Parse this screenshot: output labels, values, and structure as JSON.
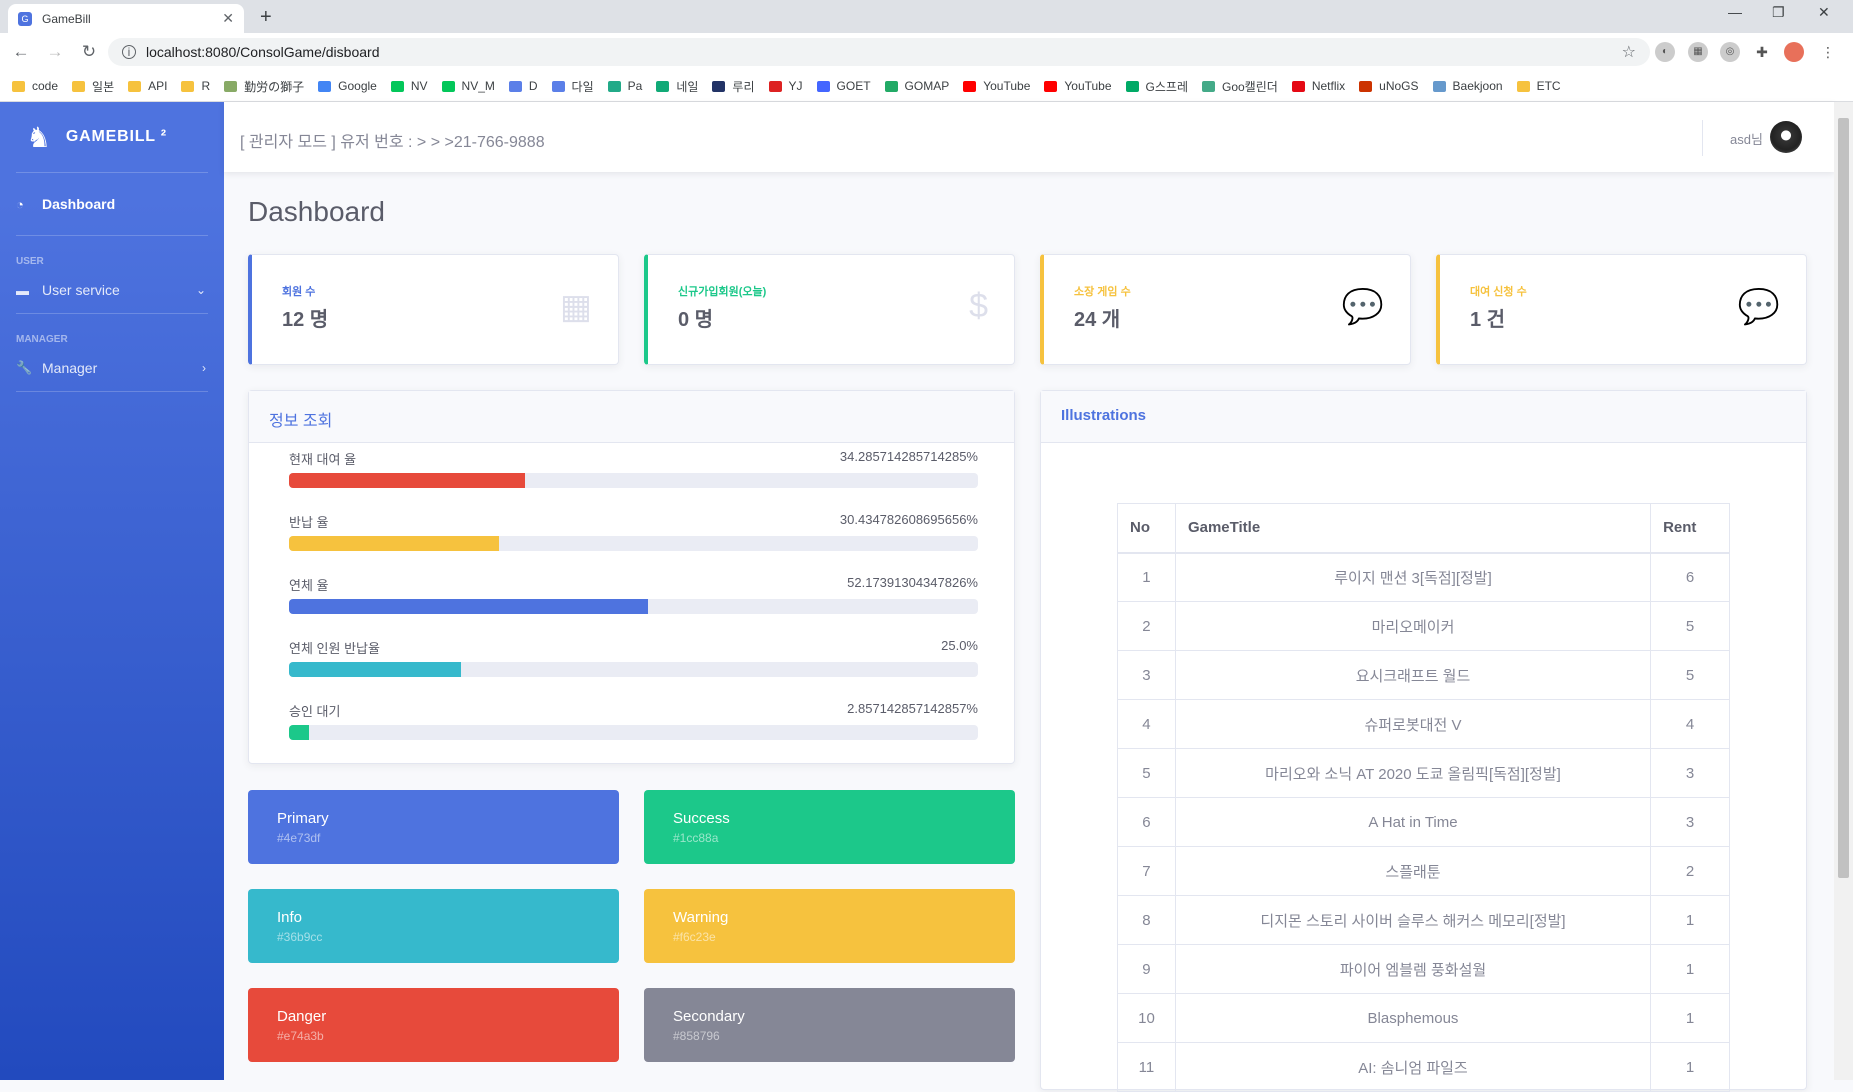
{
  "browser": {
    "tab_title": "GameBill",
    "url": "localhost:8080/ConsolGame/disboard",
    "bookmarks": [
      "code",
      "일본",
      "API",
      "R",
      "勤労の獅子",
      "Google",
      "NV",
      "NV_M",
      "D",
      "다일",
      "Pa",
      "네일",
      "루리",
      "YJ",
      "GOET",
      "GOMAP",
      "YouTube",
      "YouTube",
      "G스프레",
      "Goo캘린더",
      "Netflix",
      "uNoGS",
      "Baekjoon",
      "ETC"
    ]
  },
  "sidebar": {
    "brand": "GAMEBILL ²",
    "dashboard": "Dashboard",
    "user_heading": "USER",
    "user_service": "User service",
    "manager_heading": "MANAGER",
    "manager": "Manager"
  },
  "topbar": {
    "message": "[ 관리자 모드 ] 유저 번호 : > > >21-766-9888",
    "user": "asd님"
  },
  "page_title": "Dashboard",
  "stats": [
    {
      "label": "회원 수",
      "value": "12 명",
      "color": "#4e73df",
      "icon": "calendar-icon"
    },
    {
      "label": "신규가입회원(오늘)",
      "value": "0 명",
      "color": "#1cc88a",
      "icon": "dollar-icon"
    },
    {
      "label": "소장 게임 수",
      "value": "24 개",
      "color": "#f6c23e",
      "icon": "comments-icon"
    },
    {
      "label": "대여 신청 수",
      "value": "1 건",
      "color": "#f6c23e",
      "icon": "comments-icon"
    }
  ],
  "info_panel": {
    "title": "정보 조회",
    "progress": [
      {
        "label": "현재 대여 율",
        "value": "34.285714285714285%",
        "pct": 34.29,
        "color": "#e74a3b"
      },
      {
        "label": "반납 율",
        "value": "30.434782608695656%",
        "pct": 30.43,
        "color": "#f6c23e"
      },
      {
        "label": "연체 율",
        "value": "52.17391304347826%",
        "pct": 52.17,
        "color": "#4e73df"
      },
      {
        "label": "연체 인원 반납율",
        "value": "25.0%",
        "pct": 25.0,
        "color": "#36b9cc"
      },
      {
        "label": "승인 대기",
        "value": "2.857142857142857%",
        "pct": 2.86,
        "color": "#1cc88a"
      }
    ]
  },
  "colors": [
    {
      "name": "Primary",
      "hex": "#4e73df"
    },
    {
      "name": "Success",
      "hex": "#1cc88a"
    },
    {
      "name": "Info",
      "hex": "#36b9cc"
    },
    {
      "name": "Warning",
      "hex": "#f6c23e"
    },
    {
      "name": "Danger",
      "hex": "#e74a3b"
    },
    {
      "name": "Secondary",
      "hex": "#858796"
    }
  ],
  "illustrations": {
    "title": "Illustrations",
    "headers": [
      "No",
      "GameTitle",
      "Rent"
    ],
    "rows": [
      [
        "1",
        "루이지 맨션 3[독점][정발]",
        "6"
      ],
      [
        "2",
        "마리오메이커",
        "5"
      ],
      [
        "3",
        "요시크래프트 월드",
        "5"
      ],
      [
        "4",
        "슈퍼로봇대전 V",
        "4"
      ],
      [
        "5",
        "마리오와 소닉 AT 2020 도쿄 올림픽[독점][정발]",
        "3"
      ],
      [
        "6",
        "A Hat in Time",
        "3"
      ],
      [
        "7",
        "스플래툰",
        "2"
      ],
      [
        "8",
        "디지몬 스토리 사이버 슬루스 해커스 메모리[정발]",
        "1"
      ],
      [
        "9",
        "파이어 엠블렘 풍화설월",
        "1"
      ],
      [
        "10",
        "Blasphemous",
        "1"
      ],
      [
        "11",
        "AI: 솜니엄 파일즈",
        "1"
      ]
    ]
  }
}
